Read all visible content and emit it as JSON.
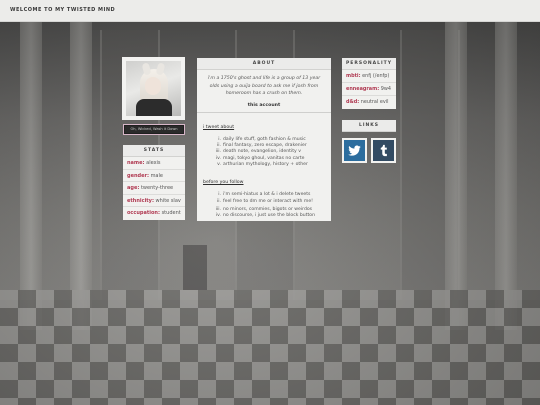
{
  "site": {
    "title": "WELCOME TO MY TWISTED MIND"
  },
  "profile": {
    "name_tag": "Oh, Wicked, Wash it Down"
  },
  "stats": {
    "heading": "STATS",
    "rows": [
      {
        "label": "name:",
        "value": "alexis"
      },
      {
        "label": "gender:",
        "value": "male"
      },
      {
        "label": "age:",
        "value": "twenty-three"
      },
      {
        "label": "ethnicity:",
        "value": "white slav"
      },
      {
        "label": "occupation:",
        "value": "student"
      }
    ]
  },
  "about": {
    "heading": "ABOUT",
    "intro": "i'm a 1750's ghost and life is a group of 13 year olds using a ouija board to ask me if josh from homeroom has a crush on them.",
    "this_account": "this account",
    "tweet_about": {
      "link": "i tweet about",
      "items": [
        {
          "num": "i.",
          "text": "daily life stuff, goth fashion & music"
        },
        {
          "num": "ii.",
          "text": "final fantasy, zero escape, drakenier"
        },
        {
          "num": "iii.",
          "text": "death note, evangelion, identity v"
        },
        {
          "num": "iv.",
          "text": "magi, tokyo ghoul, vanitas no carte"
        },
        {
          "num": "v.",
          "text": "arthurian mythology, history + other"
        }
      ]
    },
    "before_follow": {
      "link": "before you follow",
      "items": [
        {
          "num": "i.",
          "text": "i'm semi-hiatus a lot & i delete tweets"
        },
        {
          "num": "ii.",
          "text": "feel free to dm me or interact with me!"
        }
      ],
      "items2": [
        {
          "num": "iii.",
          "text": "no minors, commies, bigots or weirdos"
        },
        {
          "num": "iv.",
          "text": "no discourse, i just use the block button"
        }
      ]
    }
  },
  "personality": {
    "heading": "PERSONALITY",
    "rows": [
      {
        "label": "mbti:",
        "value": "enfj (/enfp)"
      },
      {
        "label": "enneagram:",
        "value": "9w4"
      },
      {
        "label": "d&d:",
        "value": "neutral evil"
      }
    ]
  },
  "links": {
    "heading": "LINKS",
    "icons": [
      "twitter-icon",
      "tumblr-icon"
    ]
  },
  "colors": {
    "accent": "#b03a52",
    "panel": "#f1f1ef",
    "twitter": "#2c6d9e",
    "tumblr": "#324b63"
  }
}
